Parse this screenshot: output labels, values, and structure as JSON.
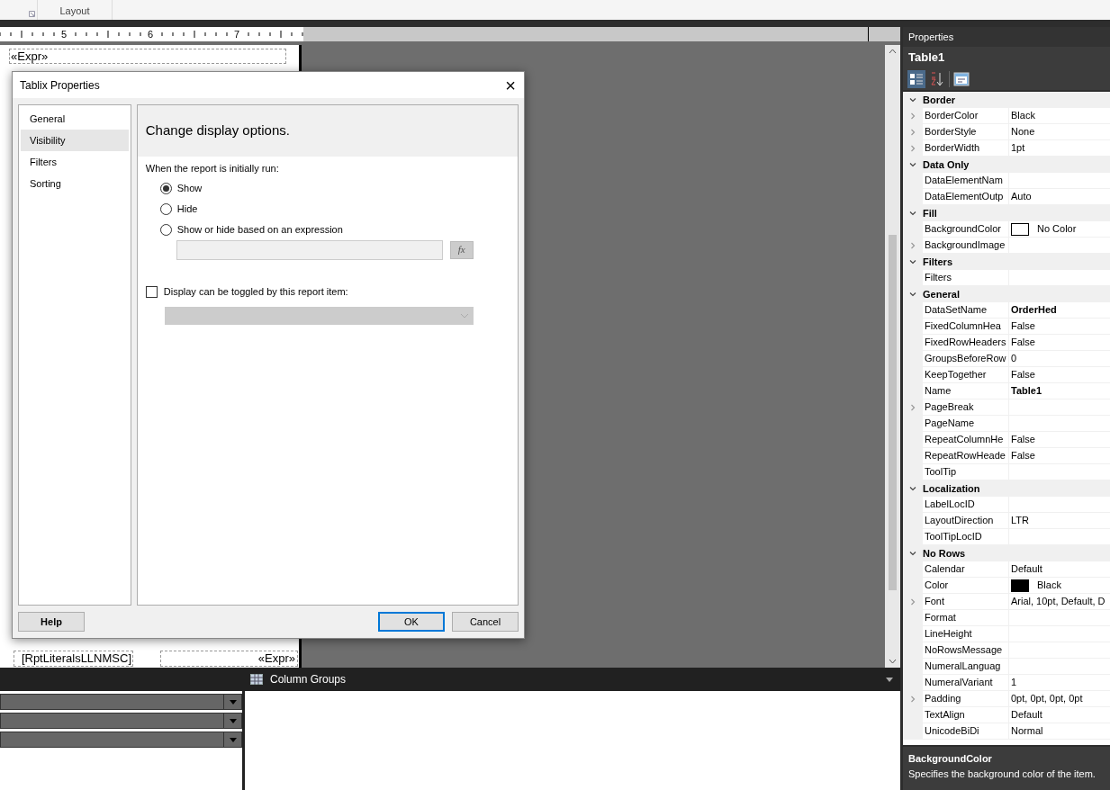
{
  "ribbon": {
    "group_label": "Layout"
  },
  "ruler": {
    "labels": [
      "5",
      "6",
      "7"
    ]
  },
  "design_surface": {
    "cells": [
      "«Expr»",
      "[RptLiteralsLLNMSC]",
      "«Expr»"
    ]
  },
  "grouping_pane": {
    "title": "Column Groups"
  },
  "properties": {
    "title": "Properties",
    "object": "Table1",
    "categories": [
      {
        "name": "Border",
        "expanded": true,
        "items": [
          {
            "name": "BorderColor",
            "value": "Black",
            "expandable": true
          },
          {
            "name": "BorderStyle",
            "value": "None",
            "expandable": true
          },
          {
            "name": "BorderWidth",
            "value": "1pt",
            "expandable": true
          }
        ]
      },
      {
        "name": "Data Only",
        "expanded": true,
        "items": [
          {
            "name": "DataElementNam",
            "expandable": false
          },
          {
            "name": "DataElementOutp",
            "value": "Auto",
            "expandable": false
          }
        ]
      },
      {
        "name": "Fill",
        "expanded": true,
        "items": [
          {
            "name": "BackgroundColor",
            "value": "No Color",
            "color": "#ffffff",
            "expandable": false
          },
          {
            "name": "BackgroundImage",
            "expandable": true
          }
        ]
      },
      {
        "name": "Filters",
        "expanded": true,
        "items": [
          {
            "name": "Filters",
            "expandable": false
          }
        ]
      },
      {
        "name": "General",
        "expanded": true,
        "items": [
          {
            "name": "DataSetName",
            "value": "OrderHed",
            "expandable": false,
            "bold": true
          },
          {
            "name": "FixedColumnHea",
            "value": "False",
            "expandable": false
          },
          {
            "name": "FixedRowHeaders",
            "value": "False",
            "expandable": false
          },
          {
            "name": "GroupsBeforeRow",
            "value": "0",
            "expandable": false
          },
          {
            "name": "KeepTogether",
            "value": "False",
            "expandable": false
          },
          {
            "name": "Name",
            "value": "Table1",
            "expandable": false,
            "bold": true
          },
          {
            "name": "PageBreak",
            "expandable": true
          },
          {
            "name": "PageName",
            "expandable": false
          },
          {
            "name": "RepeatColumnHe",
            "value": "False",
            "expandable": false
          },
          {
            "name": "RepeatRowHeade",
            "value": "False",
            "expandable": false
          },
          {
            "name": "ToolTip",
            "expandable": false
          }
        ]
      },
      {
        "name": "Localization",
        "expanded": true,
        "items": [
          {
            "name": "LabelLocID",
            "expandable": false
          },
          {
            "name": "LayoutDirection",
            "value": "LTR",
            "expandable": false
          },
          {
            "name": "ToolTipLocID",
            "expandable": false
          }
        ]
      },
      {
        "name": "No Rows",
        "expanded": true,
        "items": [
          {
            "name": "Calendar",
            "value": "Default",
            "expandable": false
          },
          {
            "name": "Color",
            "value": "Black",
            "color": "#000000",
            "expandable": false
          },
          {
            "name": "Font",
            "value": "Arial, 10pt, Default, D",
            "expandable": true
          },
          {
            "name": "Format",
            "expandable": false
          },
          {
            "name": "LineHeight",
            "expandable": false
          },
          {
            "name": "NoRowsMessage",
            "expandable": false
          },
          {
            "name": "NumeralLanguag",
            "expandable": false
          },
          {
            "name": "NumeralVariant",
            "value": "1",
            "expandable": false
          },
          {
            "name": "Padding",
            "value": "0pt, 0pt, 0pt, 0pt",
            "expandable": true
          },
          {
            "name": "TextAlign",
            "value": "Default",
            "expandable": false
          },
          {
            "name": "UnicodeBiDi",
            "value": "Normal",
            "expandable": false
          }
        ]
      }
    ],
    "description": {
      "title": "BackgroundColor",
      "text": "Specifies the background color of the item."
    }
  },
  "dialog": {
    "title": "Tablix Properties",
    "close": "×",
    "nav": [
      {
        "label": "General",
        "selected": false
      },
      {
        "label": "Visibility",
        "selected": true
      },
      {
        "label": "Filters",
        "selected": false
      },
      {
        "label": "Sorting",
        "selected": false
      }
    ],
    "heading": "Change display options.",
    "prompt": "When the report is initially run:",
    "options": [
      {
        "label": "Show",
        "selected": true
      },
      {
        "label": "Hide",
        "selected": false
      },
      {
        "label": "Show or hide based on an expression",
        "selected": false
      }
    ],
    "expression": {
      "disabled": true,
      "button": "fx"
    },
    "toggle": {
      "label": "Display can be toggled by this report item:",
      "checked": false,
      "disabled": true
    },
    "buttons": [
      {
        "label": "Help",
        "kind": "help"
      },
      {
        "label": "OK",
        "kind": "default"
      },
      {
        "label": "Cancel",
        "kind": "normal"
      }
    ]
  }
}
